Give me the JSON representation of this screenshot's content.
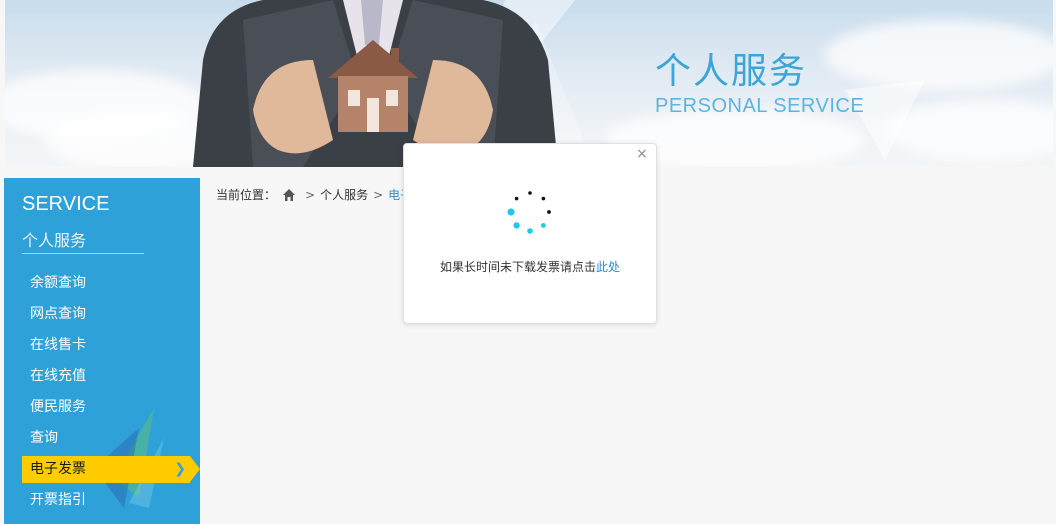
{
  "banner": {
    "title": "个人服务",
    "subtitle": "PERSONAL SERVICE"
  },
  "sidebar": {
    "heading_en": "SERVICE",
    "heading_cn": "个人服务",
    "items": [
      {
        "label": "余额查询"
      },
      {
        "label": "网点查询"
      },
      {
        "label": "在线售卡"
      },
      {
        "label": "在线充值"
      },
      {
        "label": "便民服务"
      },
      {
        "label": "查询"
      },
      {
        "label": "电子发票",
        "active": true
      },
      {
        "label": "开票指引"
      }
    ]
  },
  "breadcrumb": {
    "prefix": "当前位置：",
    "level1": "个人服务",
    "current": "电子"
  },
  "modal": {
    "close_icon": "×",
    "message": "如果长时间未下载发票请点击",
    "link_text": "此处"
  },
  "icons": {
    "home": "home-icon",
    "close": "close-icon",
    "spinner": "loading-spinner-icon",
    "active_arrow": "chevron-right-icon"
  },
  "colors": {
    "sidebar_bg": "#2ea1d8",
    "active_item_bg": "#ffcc00",
    "accent_title": "#3aa6d8",
    "link": "#2b8ecf",
    "spinner_dark": "#111111",
    "spinner_cyan": "#20c9e8"
  }
}
